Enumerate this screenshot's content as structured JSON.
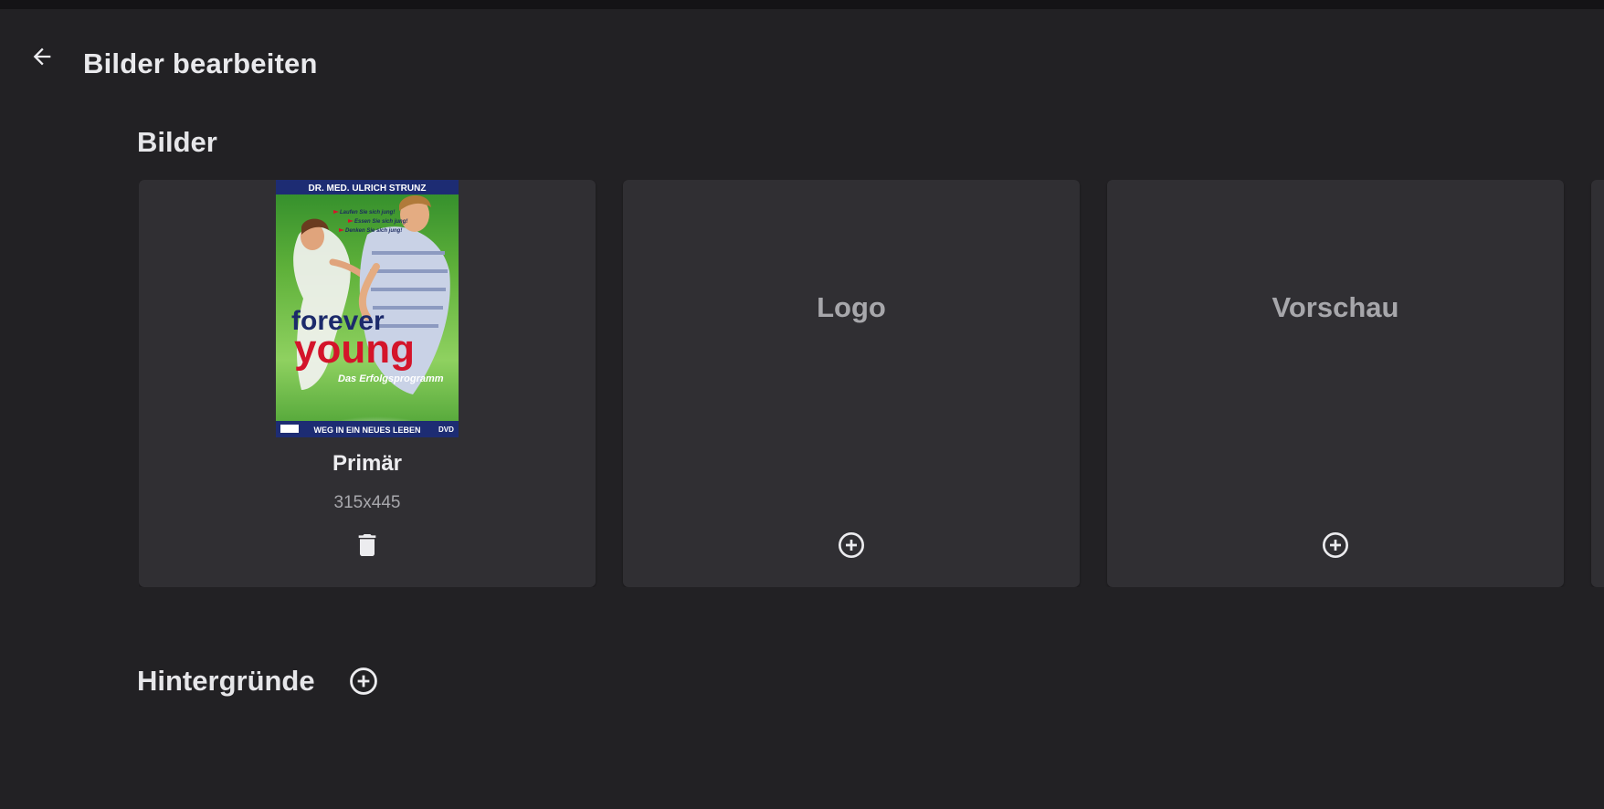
{
  "header": {
    "title": "Bilder bearbeiten",
    "back_icon": "arrow-back-icon"
  },
  "sections": {
    "images_title": "Bilder",
    "backdrops_title": "Hintergründe"
  },
  "cards": [
    {
      "type": "Primär",
      "size": "315x445",
      "action_icon": "delete-icon",
      "poster": {
        "top_banner": "DR. MED. ULRICH STRUNZ",
        "bullets": [
          "Laufen Sie sich jung!",
          "Essen Sie sich jung!",
          "Denken Sie sich jung!"
        ],
        "title_line1": "forever",
        "title_line2": "young",
        "subtitle": "Das Erfolgsprogramm",
        "bottom_banner": "WEG IN EIN NEUES LEBEN",
        "badge": "DVD"
      }
    },
    {
      "type": "Logo",
      "action_icon": "add-circle-icon"
    },
    {
      "type": "Vorschau",
      "action_icon": "add-circle-icon"
    }
  ],
  "colors": {
    "background": "#222124",
    "card": "#302f33",
    "poster_title_navy": "#1c2a6b",
    "poster_title_red": "#d4142a"
  }
}
